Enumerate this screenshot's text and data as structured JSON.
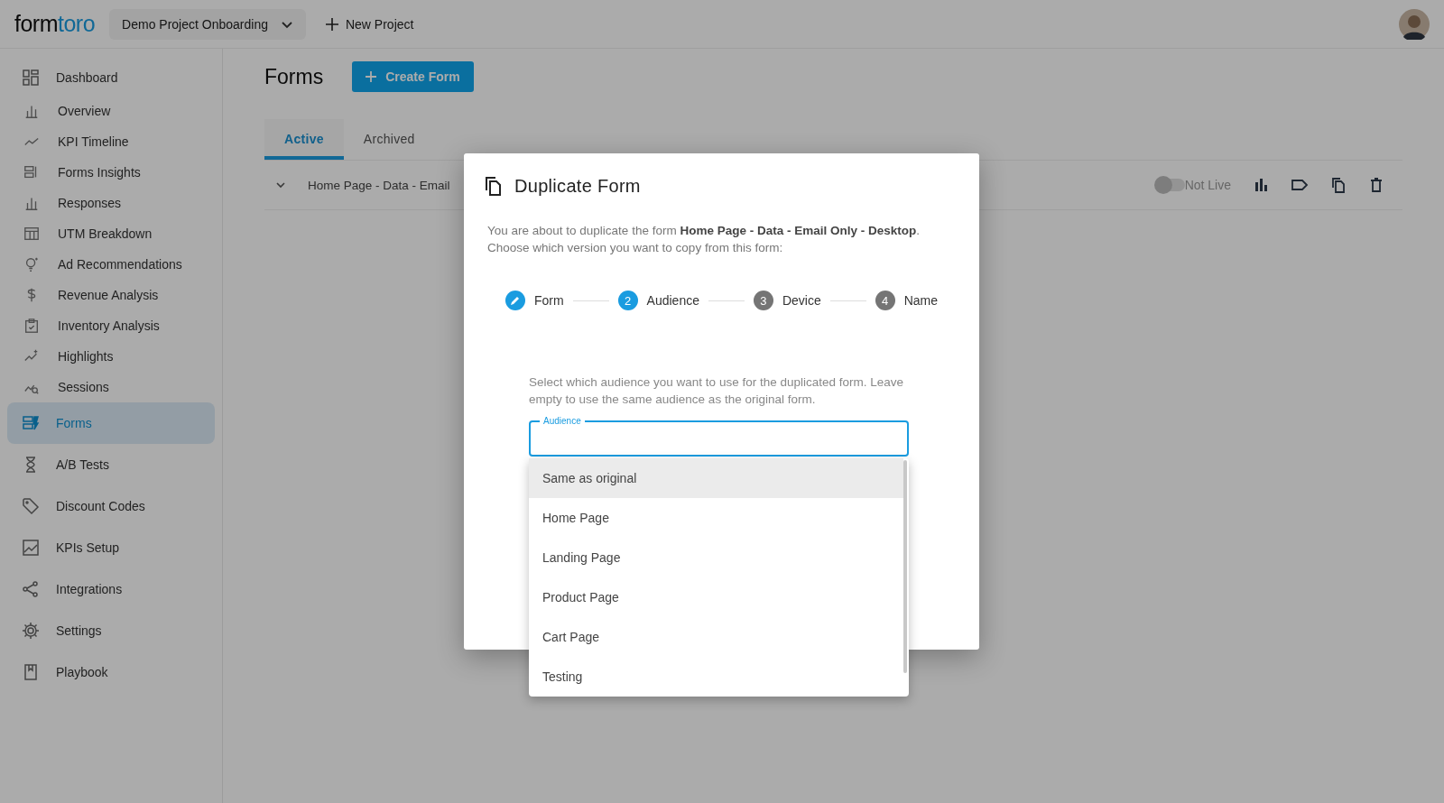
{
  "brand": {
    "name_start": "form",
    "name_end": "toro"
  },
  "topbar": {
    "project": "Demo Project Onboarding",
    "new_project": "New Project"
  },
  "sidebar": {
    "items": [
      {
        "label": "Dashboard",
        "selected": false,
        "children": [
          {
            "label": "Overview",
            "selected": false
          },
          {
            "label": "KPI Timeline",
            "selected": false
          },
          {
            "label": "Forms Insights",
            "selected": false
          },
          {
            "label": "Responses",
            "selected": false
          },
          {
            "label": "UTM Breakdown",
            "selected": false
          },
          {
            "label": "Ad Recommendations",
            "selected": false
          },
          {
            "label": "Revenue Analysis",
            "selected": false
          },
          {
            "label": "Inventory Analysis",
            "selected": false
          },
          {
            "label": "Highlights",
            "selected": false
          },
          {
            "label": "Sessions",
            "selected": false
          }
        ]
      },
      {
        "label": "Forms",
        "selected": true
      },
      {
        "label": "A/B Tests",
        "selected": false
      },
      {
        "label": "Discount Codes",
        "selected": false
      },
      {
        "label": "KPIs Setup",
        "selected": false
      },
      {
        "label": "Integrations",
        "selected": false
      },
      {
        "label": "Settings",
        "selected": false
      },
      {
        "label": "Playbook",
        "selected": false
      }
    ]
  },
  "page": {
    "title": "Forms",
    "create_button": "Create Form"
  },
  "tabs": [
    {
      "label": "Active",
      "selected": true
    },
    {
      "label": "Archived",
      "selected": false
    }
  ],
  "forms": [
    {
      "name": "Home Page - Data - Email",
      "live": false,
      "status": "Not Live"
    }
  ],
  "dialog": {
    "title": "Duplicate Form",
    "intro": "You are about to duplicate the form **Home Page - Data - Email Only - Desktop**. Choose which version you want to copy from this form:",
    "steps": [
      {
        "label": "Form",
        "kind": "done"
      },
      {
        "label": "Audience",
        "number": "2",
        "kind": "current"
      },
      {
        "label": "Device",
        "number": "3",
        "kind": "upcoming"
      },
      {
        "label": "Name",
        "number": "4",
        "kind": "upcoming"
      }
    ],
    "help": "Select which audience you want to use for the duplicated form. Leave empty to use the same audience as the original form.",
    "field": {
      "label": "Audience",
      "focused": true
    },
    "options": [
      {
        "label": "Same as original",
        "highlighted": true
      },
      {
        "label": "Home Page",
        "highlighted": false
      },
      {
        "label": "Landing Page",
        "highlighted": false
      },
      {
        "label": "Product Page",
        "highlighted": false
      },
      {
        "label": "Cart Page",
        "highlighted": false
      },
      {
        "label": "Testing",
        "highlighted": false
      }
    ]
  }
}
